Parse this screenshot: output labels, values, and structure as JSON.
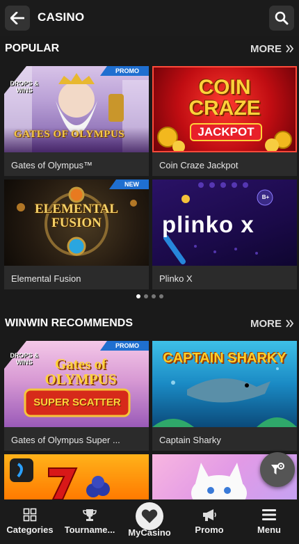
{
  "header": {
    "title": "CASINO",
    "back_icon": "arrow-left-icon",
    "search_icon": "search-icon"
  },
  "popular": {
    "heading": "POPULAR",
    "more_label": "MORE",
    "games": [
      {
        "name": "Gates of Olympus™",
        "badge": "PROMO",
        "art_text_1": "GATES OF OLYMPUS",
        "art_text_2": "DROPS & WINS"
      },
      {
        "name": "Coin Craze Jackpot",
        "badge": "",
        "art_text_1": "COIN CRAZE",
        "art_text_2": "JACKPOT"
      },
      {
        "name": "Elemental Fusion",
        "badge": "NEW",
        "art_text_1": "ELEMENTAL",
        "art_text_2": "FUSION"
      },
      {
        "name": "Plinko X",
        "badge": "",
        "art_text_1": "plinko x",
        "art_text_2": "B+"
      }
    ],
    "carousel": {
      "pages": 4,
      "active": 1
    }
  },
  "recommends": {
    "heading": "WINWIN RECOMMENDS",
    "more_label": "MORE",
    "games": [
      {
        "name": "Gates of Olympus Super ...",
        "badge": "PROMO",
        "art_text_1": "Gates of OLYMPUS",
        "art_text_2": "SUPER SCATTER",
        "art_text_3": "DROPS & WINS"
      },
      {
        "name": "Captain Sharky",
        "badge": "",
        "art_text_1": "CAPTAIN SHARKY"
      }
    ]
  },
  "nav": [
    {
      "label": "Categories",
      "icon": "grid-icon"
    },
    {
      "label": "Tourname...",
      "icon": "trophy-icon"
    },
    {
      "label": "MyCasino",
      "icon": "heart-icon"
    },
    {
      "label": "Promo",
      "icon": "megaphone-icon"
    },
    {
      "label": "Menu",
      "icon": "hamburger-icon"
    }
  ],
  "colors": {
    "background": "#1a1a1a",
    "card": "#2b2b2b",
    "badge": "#1f6fd0"
  }
}
